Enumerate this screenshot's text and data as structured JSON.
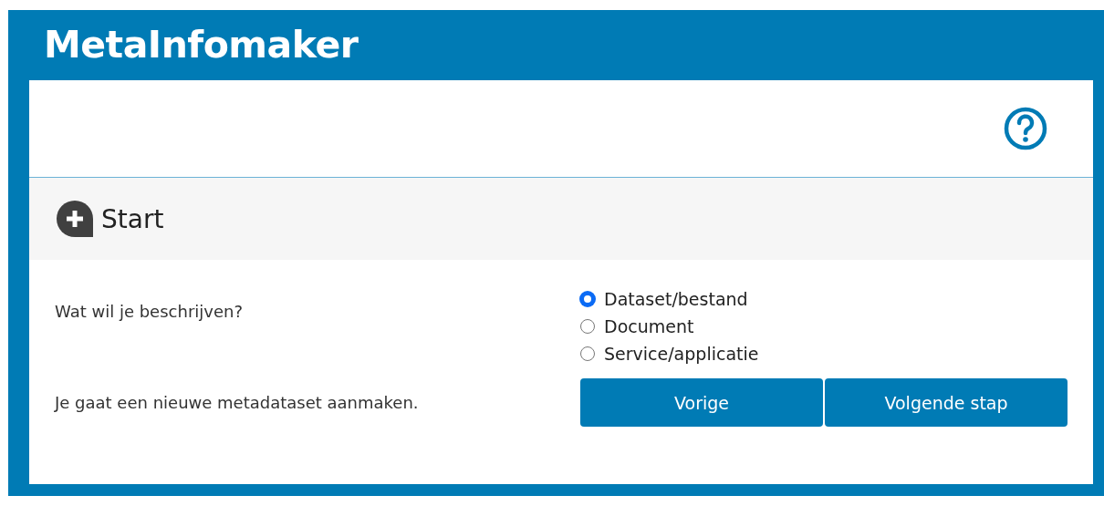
{
  "app": {
    "title": "MetaInfomaker"
  },
  "section": {
    "title": "Start"
  },
  "question": {
    "label": "Wat wil je beschrijven?",
    "options": [
      {
        "label": "Dataset/bestand",
        "selected": true
      },
      {
        "label": "Document",
        "selected": false
      },
      {
        "label": "Service/applicatie",
        "selected": false
      }
    ]
  },
  "message": "Je gaat een nieuwe metadataset aanmaken.",
  "buttons": [
    "Vorige",
    "Volgende stap"
  ]
}
